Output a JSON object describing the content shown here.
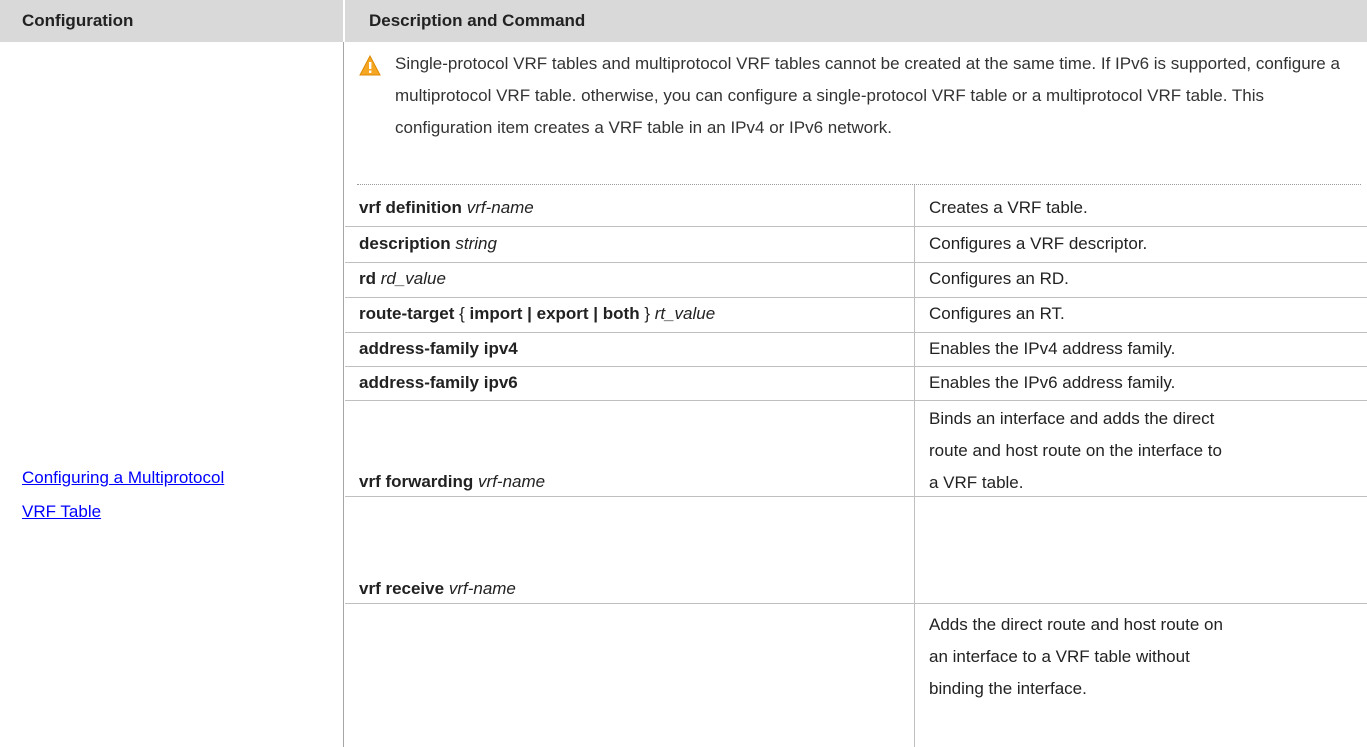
{
  "header": {
    "col1": "Configuration",
    "col2": "Description and Command"
  },
  "config_link": {
    "line1": "Configuring a Multiprotocol",
    "line2": "VRF Table"
  },
  "note": {
    "icon": "warning-icon",
    "text": "Single-protocol VRF tables and multiprotocol VRF tables cannot be created at the same time. If IPv6 is supported, configure a multiprotocol VRF table. otherwise, you can configure a single-protocol VRF table or a multiprotocol VRF table. This configuration item creates a VRF table in an IPv4 or IPv6 network."
  },
  "rows": [
    {
      "cmd_bold": "vrf definition",
      "cmd_italic": "vrf-name",
      "desc": "Creates a VRF table."
    },
    {
      "cmd_bold": "description",
      "cmd_italic": "string",
      "desc": "Configures a VRF descriptor."
    },
    {
      "cmd_bold": "rd",
      "cmd_italic": "rd_value",
      "desc": "Configures an RD."
    },
    {
      "cmd_bold": "route-target",
      "cmd_open": " { ",
      "cmd_opts": "import | export | both",
      "cmd_close": " } ",
      "cmd_italic": "rt_value",
      "desc": "Configures an RT."
    },
    {
      "cmd_bold": "address-family ipv4",
      "desc": "Enables the IPv4 address family."
    },
    {
      "cmd_bold": "address-family ipv6",
      "desc": "Enables the IPv6 address family."
    },
    {
      "cmd_bold": "vrf forwarding",
      "cmd_italic": "vrf-name",
      "desc_lines": [
        "Binds an interface and adds the direct",
        "route and host route on the interface to",
        "a VRF table."
      ]
    },
    {
      "cmd_bold": "vrf receive",
      "cmd_italic": "vrf-name",
      "desc_lines": [
        "Adds the direct route and host route on",
        "an interface to a VRF table without",
        "binding the interface."
      ]
    }
  ]
}
